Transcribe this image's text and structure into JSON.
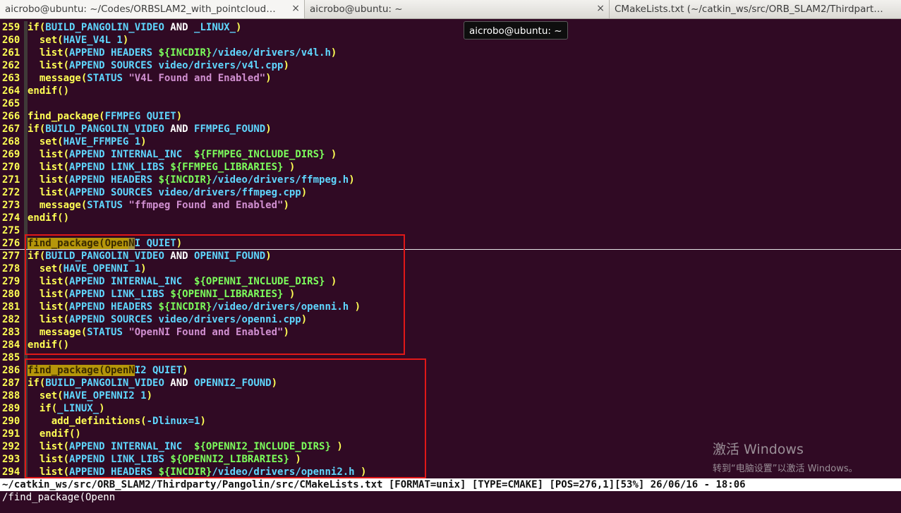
{
  "tabs": [
    {
      "label": "aicrobo@ubuntu: ~/Codes/ORBSLAM2_with_pointcloud…",
      "active": true
    },
    {
      "label": "aicrobo@ubuntu: ~",
      "active": false
    },
    {
      "label": "CMakeLists.txt (~/catkin_ws/src/ORB_SLAM2/Thirdpart…",
      "active": false
    }
  ],
  "tab_close_glyph": "×",
  "tooltip": "aicrobo@ubuntu: ~",
  "lines": [
    {
      "n": "259",
      "tokens": [
        [
          "key",
          "if("
        ],
        [
          "arg",
          "BUILD_PANGOLIN_VIDEO"
        ],
        [
          "plain",
          " AND "
        ],
        [
          "arg",
          "_LINUX_"
        ],
        [
          "key",
          ")"
        ]
      ]
    },
    {
      "n": "260",
      "tokens": [
        [
          "key",
          "  set("
        ],
        [
          "arg",
          "HAVE_V4L 1"
        ],
        [
          "key",
          ")"
        ]
      ]
    },
    {
      "n": "261",
      "tokens": [
        [
          "key",
          "  list("
        ],
        [
          "arg",
          "APPEND HEADERS "
        ],
        [
          "var",
          "${INCDIR}"
        ],
        [
          "arg",
          "/video/drivers/v4l.h"
        ],
        [
          "key",
          ")"
        ]
      ]
    },
    {
      "n": "262",
      "tokens": [
        [
          "key",
          "  list("
        ],
        [
          "arg",
          "APPEND SOURCES video/drivers/v4l.cpp"
        ],
        [
          "key",
          ")"
        ]
      ]
    },
    {
      "n": "263",
      "tokens": [
        [
          "key",
          "  message("
        ],
        [
          "arg",
          "STATUS "
        ],
        [
          "str",
          "\"V4L Found and Enabled\""
        ],
        [
          "key",
          ")"
        ]
      ]
    },
    {
      "n": "264",
      "tokens": [
        [
          "key",
          "endif()"
        ]
      ]
    },
    {
      "n": "265",
      "tokens": []
    },
    {
      "n": "266",
      "tokens": [
        [
          "key",
          "find_package("
        ],
        [
          "arg",
          "FFMPEG QUIET"
        ],
        [
          "key",
          ")"
        ]
      ]
    },
    {
      "n": "267",
      "tokens": [
        [
          "key",
          "if("
        ],
        [
          "arg",
          "BUILD_PANGOLIN_VIDEO"
        ],
        [
          "plain",
          " AND "
        ],
        [
          "arg",
          "FFMPEG_FOUND"
        ],
        [
          "key",
          ")"
        ]
      ]
    },
    {
      "n": "268",
      "tokens": [
        [
          "key",
          "  set("
        ],
        [
          "arg",
          "HAVE_FFMPEG 1"
        ],
        [
          "key",
          ")"
        ]
      ]
    },
    {
      "n": "269",
      "tokens": [
        [
          "key",
          "  list("
        ],
        [
          "arg",
          "APPEND INTERNAL_INC  "
        ],
        [
          "var",
          "${FFMPEG_INCLUDE_DIRS}"
        ],
        [
          "arg",
          " "
        ],
        [
          "key",
          ")"
        ]
      ]
    },
    {
      "n": "270",
      "tokens": [
        [
          "key",
          "  list("
        ],
        [
          "arg",
          "APPEND LINK_LIBS "
        ],
        [
          "var",
          "${FFMPEG_LIBRARIES}"
        ],
        [
          "arg",
          " "
        ],
        [
          "key",
          ")"
        ]
      ]
    },
    {
      "n": "271",
      "tokens": [
        [
          "key",
          "  list("
        ],
        [
          "arg",
          "APPEND HEADERS "
        ],
        [
          "var",
          "${INCDIR}"
        ],
        [
          "arg",
          "/video/drivers/ffmpeg.h"
        ],
        [
          "key",
          ")"
        ]
      ]
    },
    {
      "n": "272",
      "tokens": [
        [
          "key",
          "  list("
        ],
        [
          "arg",
          "APPEND SOURCES video/drivers/ffmpeg.cpp"
        ],
        [
          "key",
          ")"
        ]
      ]
    },
    {
      "n": "273",
      "tokens": [
        [
          "key",
          "  message("
        ],
        [
          "arg",
          "STATUS "
        ],
        [
          "str",
          "\"ffmpeg Found and Enabled\""
        ],
        [
          "key",
          ")"
        ]
      ]
    },
    {
      "n": "274",
      "tokens": [
        [
          "key",
          "endif()"
        ]
      ]
    },
    {
      "n": "275",
      "tokens": []
    },
    {
      "n": "276",
      "cursorline": true,
      "tokens": [
        [
          "hl",
          "find_package(Open"
        ],
        [
          "cur",
          "N"
        ],
        [
          "arg",
          "I QUIET"
        ],
        [
          "key",
          ")"
        ]
      ]
    },
    {
      "n": "277",
      "tokens": [
        [
          "key",
          "if("
        ],
        [
          "arg",
          "BUILD_PANGOLIN_VIDEO"
        ],
        [
          "plain",
          " AND "
        ],
        [
          "arg",
          "OPENNI_FOUND"
        ],
        [
          "key",
          ")"
        ]
      ]
    },
    {
      "n": "278",
      "tokens": [
        [
          "key",
          "  set("
        ],
        [
          "arg",
          "HAVE_OPENNI 1"
        ],
        [
          "key",
          ")"
        ]
      ]
    },
    {
      "n": "279",
      "tokens": [
        [
          "key",
          "  list("
        ],
        [
          "arg",
          "APPEND INTERNAL_INC  "
        ],
        [
          "var",
          "${OPENNI_INCLUDE_DIRS}"
        ],
        [
          "arg",
          " "
        ],
        [
          "key",
          ")"
        ]
      ]
    },
    {
      "n": "280",
      "tokens": [
        [
          "key",
          "  list("
        ],
        [
          "arg",
          "APPEND LINK_LIBS "
        ],
        [
          "var",
          "${OPENNI_LIBRARIES}"
        ],
        [
          "arg",
          " "
        ],
        [
          "key",
          ")"
        ]
      ]
    },
    {
      "n": "281",
      "tokens": [
        [
          "key",
          "  list("
        ],
        [
          "arg",
          "APPEND HEADERS "
        ],
        [
          "var",
          "${INCDIR}"
        ],
        [
          "arg",
          "/video/drivers/openni.h "
        ],
        [
          "key",
          ")"
        ]
      ]
    },
    {
      "n": "282",
      "tokens": [
        [
          "key",
          "  list("
        ],
        [
          "arg",
          "APPEND SOURCES video/drivers/openni.cpp"
        ],
        [
          "key",
          ")"
        ]
      ]
    },
    {
      "n": "283",
      "tokens": [
        [
          "key",
          "  message("
        ],
        [
          "arg",
          "STATUS "
        ],
        [
          "str",
          "\"OpenNI Found and Enabled\""
        ],
        [
          "key",
          ")"
        ]
      ]
    },
    {
      "n": "284",
      "tokens": [
        [
          "key",
          "endif()"
        ]
      ]
    },
    {
      "n": "285",
      "tokens": []
    },
    {
      "n": "286",
      "tokens": [
        [
          "hl",
          "find_package(OpenN"
        ],
        [
          "arg",
          "I2 QUIET"
        ],
        [
          "key",
          ")"
        ]
      ]
    },
    {
      "n": "287",
      "tokens": [
        [
          "key",
          "if("
        ],
        [
          "arg",
          "BUILD_PANGOLIN_VIDEO"
        ],
        [
          "plain",
          " AND "
        ],
        [
          "arg",
          "OPENNI2_FOUND"
        ],
        [
          "key",
          ")"
        ]
      ]
    },
    {
      "n": "288",
      "tokens": [
        [
          "key",
          "  set("
        ],
        [
          "arg",
          "HAVE_OPENNI2 1"
        ],
        [
          "key",
          ")"
        ]
      ]
    },
    {
      "n": "289",
      "tokens": [
        [
          "key",
          "  if("
        ],
        [
          "arg",
          "_LINUX_"
        ],
        [
          "key",
          ")"
        ]
      ]
    },
    {
      "n": "290",
      "tokens": [
        [
          "key",
          "    add_definitions("
        ],
        [
          "arg",
          "-Dlinux=1"
        ],
        [
          "key",
          ")"
        ]
      ]
    },
    {
      "n": "291",
      "tokens": [
        [
          "key",
          "  endif()"
        ]
      ]
    },
    {
      "n": "292",
      "tokens": [
        [
          "key",
          "  list("
        ],
        [
          "arg",
          "APPEND INTERNAL_INC  "
        ],
        [
          "var",
          "${OPENNI2_INCLUDE_DIRS}"
        ],
        [
          "arg",
          " "
        ],
        [
          "key",
          ")"
        ]
      ]
    },
    {
      "n": "293",
      "tokens": [
        [
          "key",
          "  list("
        ],
        [
          "arg",
          "APPEND LINK_LIBS "
        ],
        [
          "var",
          "${OPENNI2_LIBRARIES}"
        ],
        [
          "arg",
          " "
        ],
        [
          "key",
          ")"
        ]
      ]
    },
    {
      "n": "294",
      "tokens": [
        [
          "key",
          "  list("
        ],
        [
          "arg",
          "APPEND HEADERS "
        ],
        [
          "var",
          "${INCDIR}"
        ],
        [
          "arg",
          "/video/drivers/openni2.h "
        ],
        [
          "key",
          ")"
        ]
      ]
    }
  ],
  "statusline": "~/catkin_ws/src/ORB_SLAM2/Thirdparty/Pangolin/src/CMakeLists.txt [FORMAT=unix] [TYPE=CMAKE] [POS=276,1][53%] 26/06/16 - 18:06",
  "cmdline": "/find_package(Openn",
  "watermark": {
    "title": "激活 Windows",
    "subtitle": "转到“电脑设置”以激活 Windows。"
  },
  "colors": {
    "background": "#300a24",
    "line_number": "#ffff54",
    "keyword": "#ffff54",
    "argument": "#5fd7ff",
    "string": "#d08fd0",
    "variable": "#7cff5c",
    "search_highlight": "#b5960a",
    "annotation_box": "#e01818"
  }
}
